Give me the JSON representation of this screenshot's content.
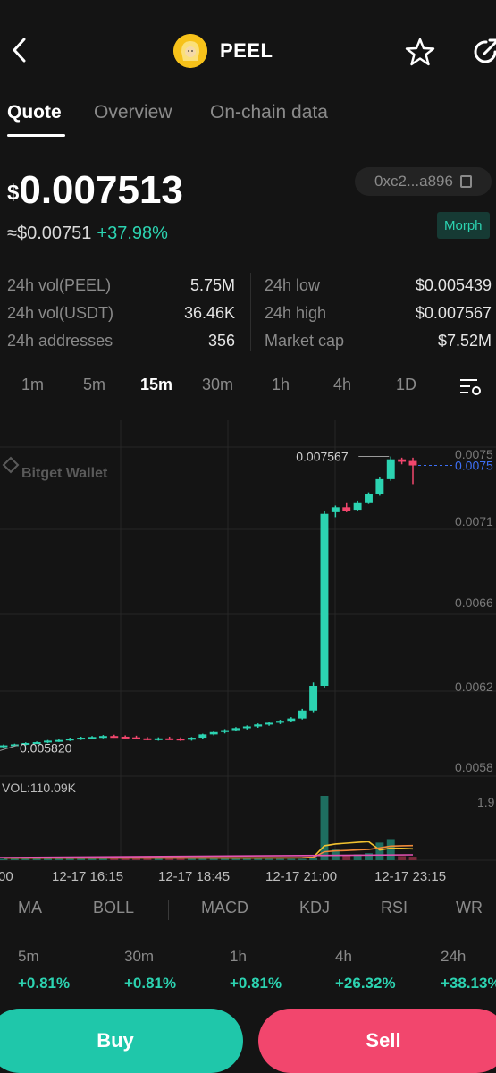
{
  "header": {
    "token_name": "PEEL",
    "icons": {
      "back": "chevron-left-icon",
      "favorite": "star-icon",
      "share": "share-icon"
    }
  },
  "tabs": [
    {
      "label": "Quote",
      "active": true
    },
    {
      "label": "Overview",
      "active": false
    },
    {
      "label": "On-chain data",
      "active": false
    }
  ],
  "price": {
    "currency_symbol": "$",
    "value": "0.007513",
    "approx": "≈$0.00751",
    "change": "+37.98%",
    "contract": "0xc2...a896",
    "chain": "Morph"
  },
  "stats": {
    "left": [
      {
        "label": "24h vol(PEEL)",
        "value": "5.75M"
      },
      {
        "label": "24h vol(USDT)",
        "value": "36.46K"
      },
      {
        "label": "24h addresses",
        "value": "356"
      }
    ],
    "right": [
      {
        "label": "24h low",
        "value": "$0.005439"
      },
      {
        "label": "24h high",
        "value": "$0.007567"
      },
      {
        "label": "Market cap",
        "value": "$7.52M"
      }
    ]
  },
  "intervals": [
    {
      "label": "1m",
      "active": false
    },
    {
      "label": "5m",
      "active": false
    },
    {
      "label": "15m",
      "active": true
    },
    {
      "label": "30m",
      "active": false
    },
    {
      "label": "1h",
      "active": false
    },
    {
      "label": "4h",
      "active": false
    },
    {
      "label": "1D",
      "active": false
    }
  ],
  "chart": {
    "watermark": "Bitget Wallet",
    "high_label": "0.007567",
    "low_label": "0.005820",
    "current_price_label": "0.0075",
    "volume_label": "VOL:110.09K",
    "volume_axis_label": "1.9",
    "price_axis": [
      "0.0075",
      "0.0071",
      "0.0066",
      "0.0062",
      "0.0058"
    ],
    "time_axis": [
      "00",
      "12-17 16:15",
      "12-17 18:45",
      "12-17 21:00",
      "12-17 23:15"
    ],
    "colors": {
      "up": "#2cd3b1",
      "down": "#f2466d",
      "current_line": "#3d6ff5",
      "ma_yellow": "#f2c230",
      "ma_orange": "#ef8a3a",
      "ma_pink": "#e552b5"
    }
  },
  "chart_data": {
    "type": "candlestick",
    "price_ylim": [
      0.00565,
      0.00757
    ],
    "candles": [
      {
        "o": 0.005812,
        "h": 0.005825,
        "l": 0.005805,
        "c": 0.00582
      },
      {
        "o": 0.00582,
        "h": 0.00583,
        "l": 0.005815,
        "c": 0.005826
      },
      {
        "o": 0.005826,
        "h": 0.005838,
        "l": 0.00582,
        "c": 0.005834
      },
      {
        "o": 0.005834,
        "h": 0.005843,
        "l": 0.005828,
        "c": 0.005839
      },
      {
        "o": 0.005839,
        "h": 0.005852,
        "l": 0.005833,
        "c": 0.005848
      },
      {
        "o": 0.005848,
        "h": 0.005858,
        "l": 0.00584,
        "c": 0.005852
      },
      {
        "o": 0.005852,
        "h": 0.005866,
        "l": 0.005846,
        "c": 0.00586
      },
      {
        "o": 0.00586,
        "h": 0.005872,
        "l": 0.005852,
        "c": 0.005866
      },
      {
        "o": 0.005866,
        "h": 0.005876,
        "l": 0.005858,
        "c": 0.00587
      },
      {
        "o": 0.00587,
        "h": 0.005882,
        "l": 0.005862,
        "c": 0.005876
      },
      {
        "o": 0.005876,
        "h": 0.005884,
        "l": 0.005866,
        "c": 0.005872
      },
      {
        "o": 0.005872,
        "h": 0.00588,
        "l": 0.005862,
        "c": 0.005868
      },
      {
        "o": 0.005868,
        "h": 0.005878,
        "l": 0.005858,
        "c": 0.005862
      },
      {
        "o": 0.005862,
        "h": 0.00587,
        "l": 0.00585,
        "c": 0.005856
      },
      {
        "o": 0.005856,
        "h": 0.005868,
        "l": 0.005848,
        "c": 0.005862
      },
      {
        "o": 0.005862,
        "h": 0.005872,
        "l": 0.005852,
        "c": 0.00586
      },
      {
        "o": 0.00586,
        "h": 0.005868,
        "l": 0.005846,
        "c": 0.005854
      },
      {
        "o": 0.005854,
        "h": 0.00587,
        "l": 0.005848,
        "c": 0.005866
      },
      {
        "o": 0.005866,
        "h": 0.00589,
        "l": 0.00586,
        "c": 0.005886
      },
      {
        "o": 0.005886,
        "h": 0.005906,
        "l": 0.00588,
        "c": 0.0059
      },
      {
        "o": 0.0059,
        "h": 0.005918,
        "l": 0.005892,
        "c": 0.005912
      },
      {
        "o": 0.005912,
        "h": 0.00593,
        "l": 0.005904,
        "c": 0.005924
      },
      {
        "o": 0.005924,
        "h": 0.00594,
        "l": 0.005916,
        "c": 0.005934
      },
      {
        "o": 0.005934,
        "h": 0.005952,
        "l": 0.005926,
        "c": 0.005946
      },
      {
        "o": 0.005946,
        "h": 0.005962,
        "l": 0.005938,
        "c": 0.005956
      },
      {
        "o": 0.005956,
        "h": 0.005974,
        "l": 0.005948,
        "c": 0.005968
      },
      {
        "o": 0.005968,
        "h": 0.00599,
        "l": 0.00596,
        "c": 0.005982
      },
      {
        "o": 0.005982,
        "h": 0.00604,
        "l": 0.005976,
        "c": 0.00603
      },
      {
        "o": 0.00603,
        "h": 0.0062,
        "l": 0.00602,
        "c": 0.00618
      },
      {
        "o": 0.00618,
        "h": 0.00724,
        "l": 0.00617,
        "c": 0.00722
      },
      {
        "o": 0.00723,
        "h": 0.00727,
        "l": 0.0072,
        "c": 0.00726
      },
      {
        "o": 0.00726,
        "h": 0.00729,
        "l": 0.00723,
        "c": 0.00724
      },
      {
        "o": 0.007245,
        "h": 0.0073,
        "l": 0.00724,
        "c": 0.00729
      },
      {
        "o": 0.00729,
        "h": 0.00735,
        "l": 0.00728,
        "c": 0.00734
      },
      {
        "o": 0.00734,
        "h": 0.00744,
        "l": 0.00733,
        "c": 0.00743
      },
      {
        "o": 0.00743,
        "h": 0.007567,
        "l": 0.00742,
        "c": 0.00755
      },
      {
        "o": 0.00755,
        "h": 0.00756,
        "l": 0.00752,
        "c": 0.007535
      },
      {
        "o": 0.00754,
        "h": 0.00756,
        "l": 0.0074,
        "c": 0.007513
      }
    ],
    "volumes": [
      1.0,
      0.8,
      0.9,
      0.7,
      1.0,
      0.8,
      0.9,
      1.1,
      0.7,
      0.9,
      0.8,
      0.7,
      0.9,
      0.8,
      1.0,
      0.9,
      1.0,
      0.8,
      1.1,
      1.0,
      1.2,
      1.0,
      1.1,
      1.2,
      1.3,
      1.2,
      1.4,
      2.0,
      5.0,
      110.09,
      18.0,
      9.0,
      10.0,
      12.0,
      30.0,
      36.0,
      7.0,
      6.0
    ]
  },
  "indicators": [
    "MA",
    "BOLL",
    "MACD",
    "KDJ",
    "RSI",
    "WR"
  ],
  "performance": [
    {
      "label": "5m",
      "value": "+0.81%"
    },
    {
      "label": "30m",
      "value": "+0.81%"
    },
    {
      "label": "1h",
      "value": "+0.81%"
    },
    {
      "label": "4h",
      "value": "+26.32%"
    },
    {
      "label": "24h",
      "value": "+38.13%"
    }
  ],
  "actions": {
    "buy": "Buy",
    "sell": "Sell"
  }
}
